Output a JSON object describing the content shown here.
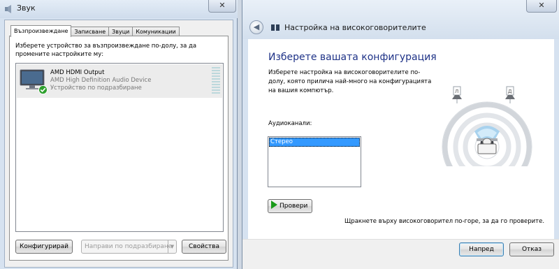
{
  "sound_dialog": {
    "title": "Звук",
    "close_glyph": "✕",
    "tabs": [
      {
        "label": "Възпроизвеждане",
        "active": true
      },
      {
        "label": "Записване",
        "active": false
      },
      {
        "label": "Звуци",
        "active": false
      },
      {
        "label": "Комуникации",
        "active": false
      }
    ],
    "instruction": "Изберете устройство за възпроизвеждане по-долу, за да промените настройките му:",
    "devices": [
      {
        "icon": "monitor-icon",
        "name": "AMD HDMI Output",
        "description": "AMD High Definition Audio Device",
        "status": "Устройство по подразбиране",
        "is_default": true
      }
    ],
    "buttons": {
      "configure": "Конфигурирай",
      "set_default": "Направи по подразбиране",
      "set_default_arrow": "▼",
      "properties": "Свойства"
    }
  },
  "speaker_wizard": {
    "title": "Настройка на високоговорителите",
    "close_glyph": "✕",
    "back_glyph": "◀",
    "heading": "Изберете вашата конфигурация",
    "instruction": "Изберете настройка на високоговорителите по-долу, която прилича най-много на конфигурацията на вашия компютър.",
    "channels_label": "Аудиоканали:",
    "channels": [
      "Стерео"
    ],
    "selected_channel": "Стерео",
    "test_button": "Провери",
    "hint": "Щракнете върху високоговорител по-горе, за да го проверите.",
    "speaker_labels": {
      "left": "Л",
      "right": "Д"
    },
    "buttons": {
      "next": "Напред",
      "cancel": "Отказ"
    }
  },
  "colors": {
    "heading_blue": "#1e3287",
    "selection_blue": "#3399ff",
    "play_green": "#1a9a1a",
    "default_check_green": "#2ea02e"
  }
}
